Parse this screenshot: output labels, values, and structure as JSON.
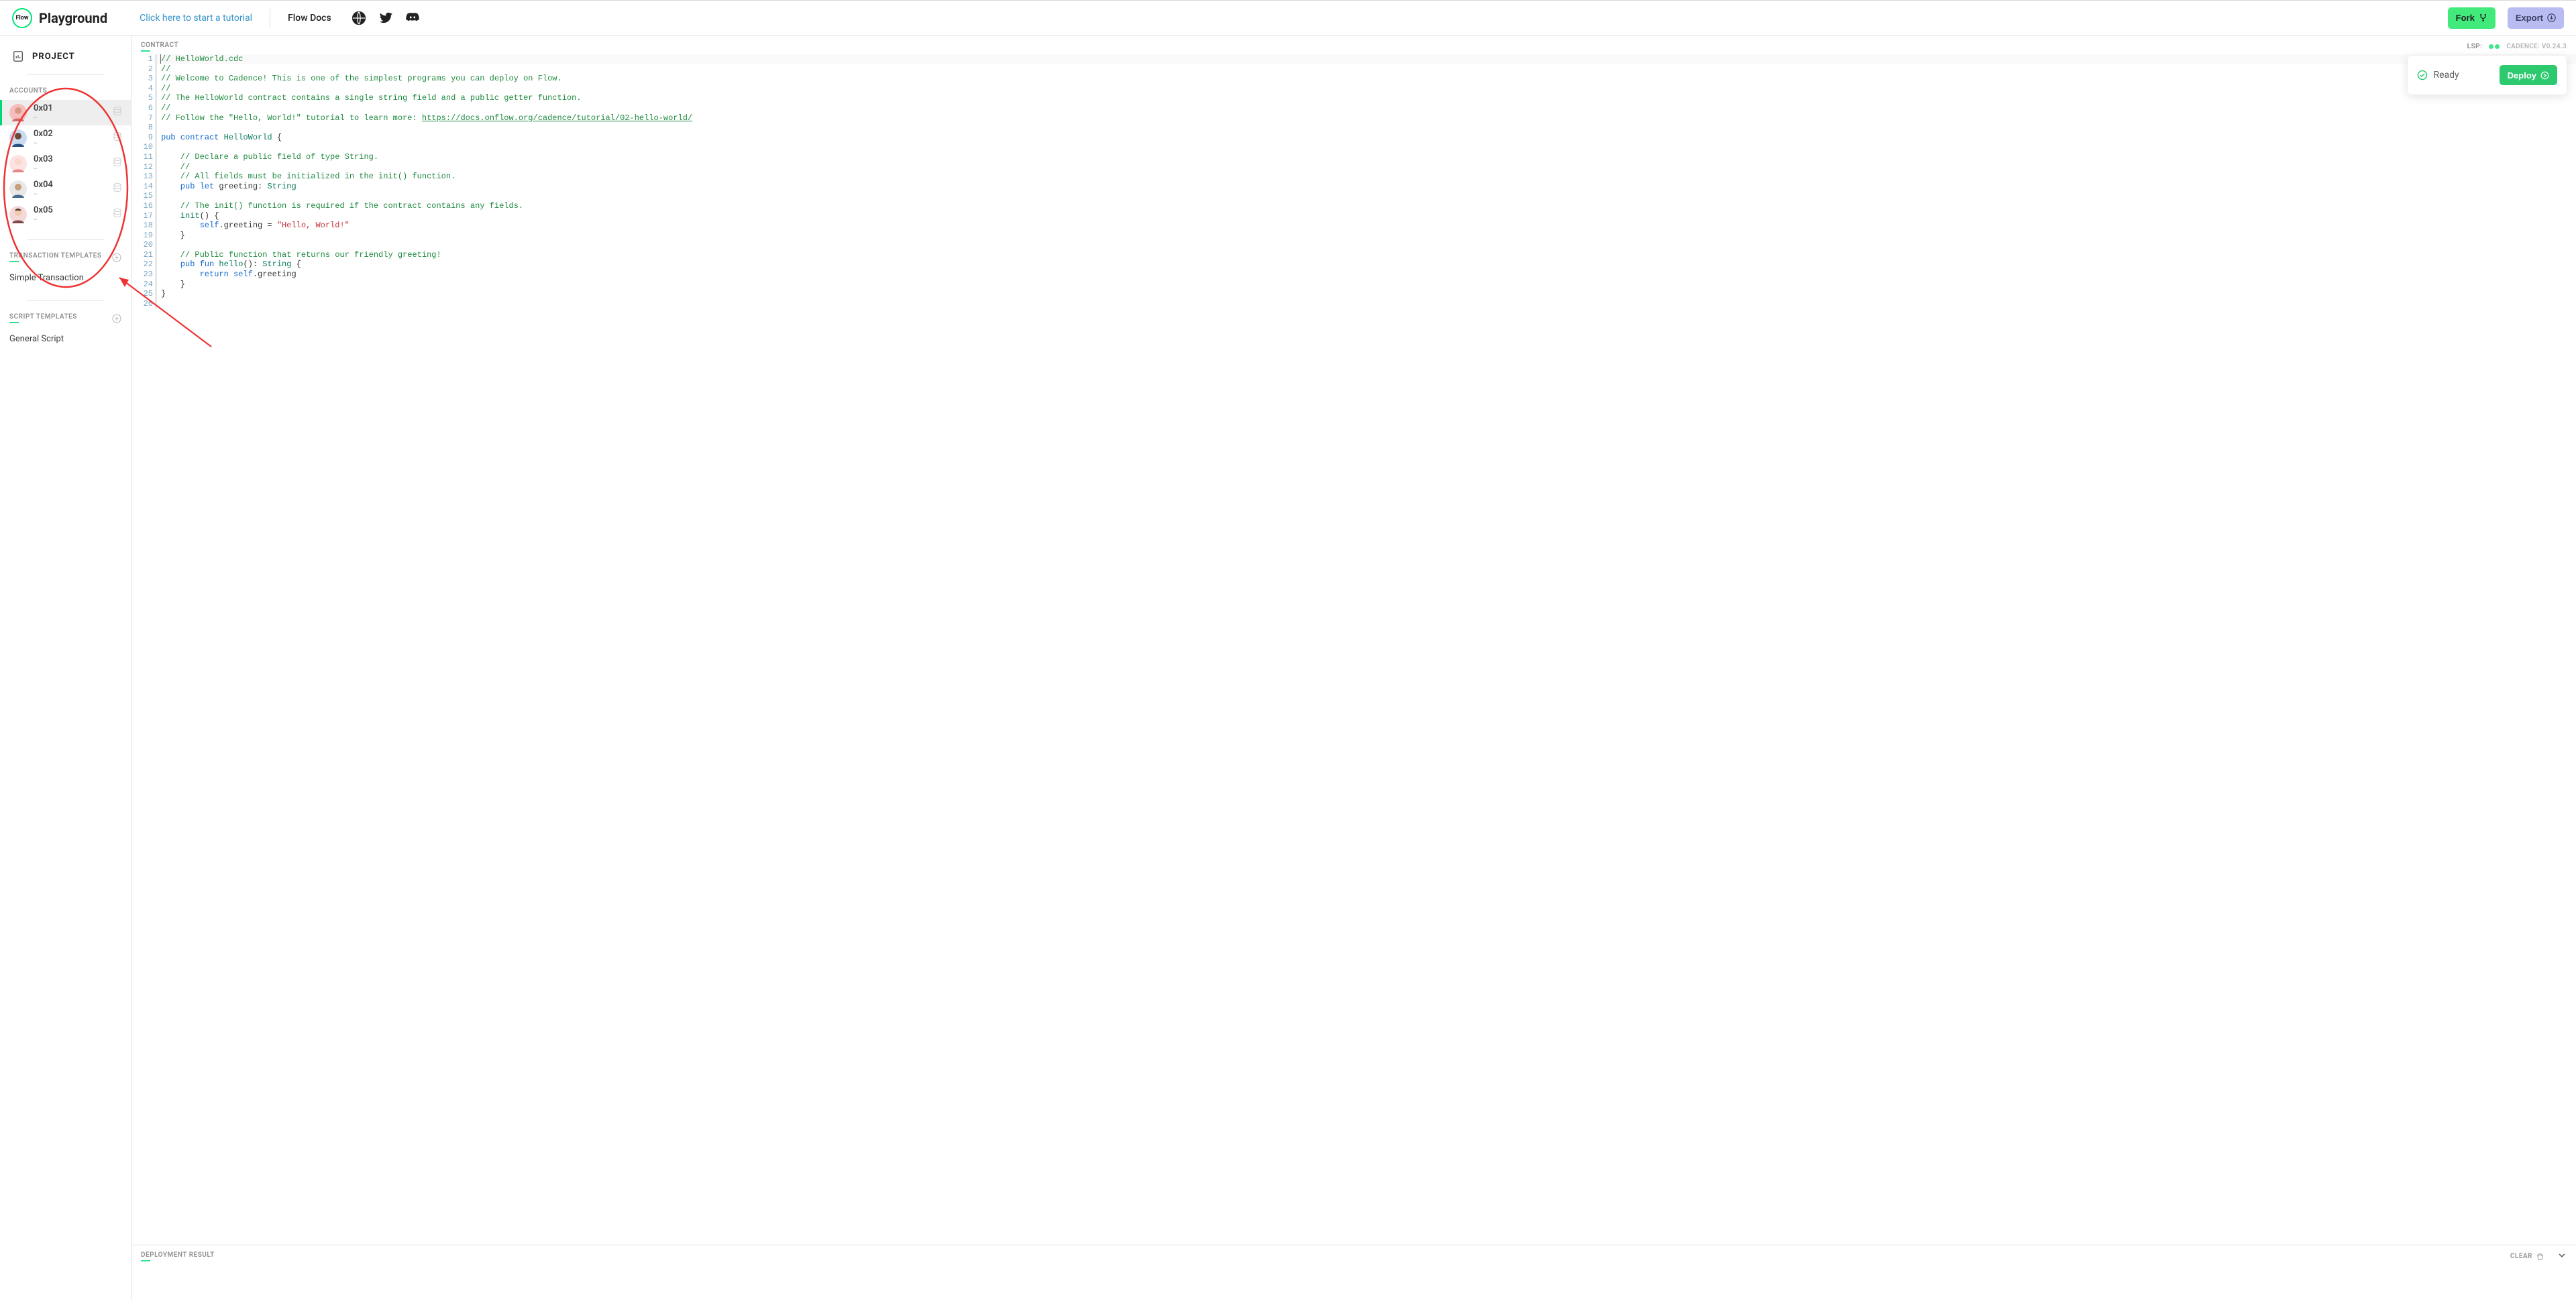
{
  "header": {
    "logo_text": "Flow",
    "app_title": "Playground",
    "tutorial_link": "Click here to start a tutorial",
    "docs_link": "Flow Docs",
    "fork_label": "Fork",
    "export_label": "Export"
  },
  "sidebar": {
    "project_label": "PROJECT",
    "accounts_label": "ACCOUNTS",
    "accounts": [
      {
        "addr": "0x01",
        "sub": "--"
      },
      {
        "addr": "0x02",
        "sub": "--"
      },
      {
        "addr": "0x03",
        "sub": "--"
      },
      {
        "addr": "0x04",
        "sub": "--"
      },
      {
        "addr": "0x05",
        "sub": "--"
      }
    ],
    "tx_templates_label": "TRANSACTION TEMPLATES",
    "tx_items": [
      "Simple Transaction"
    ],
    "script_templates_label": "SCRIPT TEMPLATES",
    "script_items": [
      "General Script"
    ]
  },
  "editor": {
    "tab_label": "CONTRACT",
    "lsp_label": "LSP:",
    "cadence_label": "CADENCE: V0.24.3",
    "ready_label": "Ready",
    "deploy_label": "Deploy",
    "code_url": "https://docs.onflow.org/cadence/tutorial/02-hello-world/",
    "code": {
      "l1": "// HelloWorld.cdc",
      "l2": "//",
      "l3": "// Welcome to Cadence! This is one of the simplest programs you can deploy on Flow.",
      "l4": "//",
      "l5": "// The HelloWorld contract contains a single string field and a public getter function.",
      "l6": "//",
      "l7a": "// Follow the \"Hello, World!\" tutorial to learn more: ",
      "l9_pub": "pub ",
      "l9_contract": "contract ",
      "l9_name": "HelloWorld",
      "l9_brace": " {",
      "l11": "    // Declare a public field of type String.",
      "l12": "    //",
      "l13": "    // All fields must be initialized in the init() function.",
      "l14_pub": "    pub ",
      "l14_let": "let ",
      "l14_name": "greeting",
      "l14_colon": ": ",
      "l14_type": "String",
      "l16": "    // The init() function is required if the contract contains any fields.",
      "l17_init": "    init",
      "l17_rest": "() {",
      "l18_self": "        self",
      "l18_mid": ".greeting = ",
      "l18_str": "\"Hello, World!\"",
      "l19": "    }",
      "l21": "    // Public function that returns our friendly greeting!",
      "l22_pub": "    pub ",
      "l22_fun": "fun ",
      "l22_name": "hello",
      "l22_sig": "(): ",
      "l22_type": "String",
      "l22_brace": " {",
      "l23_ret": "        return ",
      "l23_self": "self",
      "l23_rest": ".greeting",
      "l24": "    }",
      "l25": "}"
    }
  },
  "footer": {
    "result_label": "DEPLOYMENT RESULT",
    "clear_label": "CLEAR"
  }
}
